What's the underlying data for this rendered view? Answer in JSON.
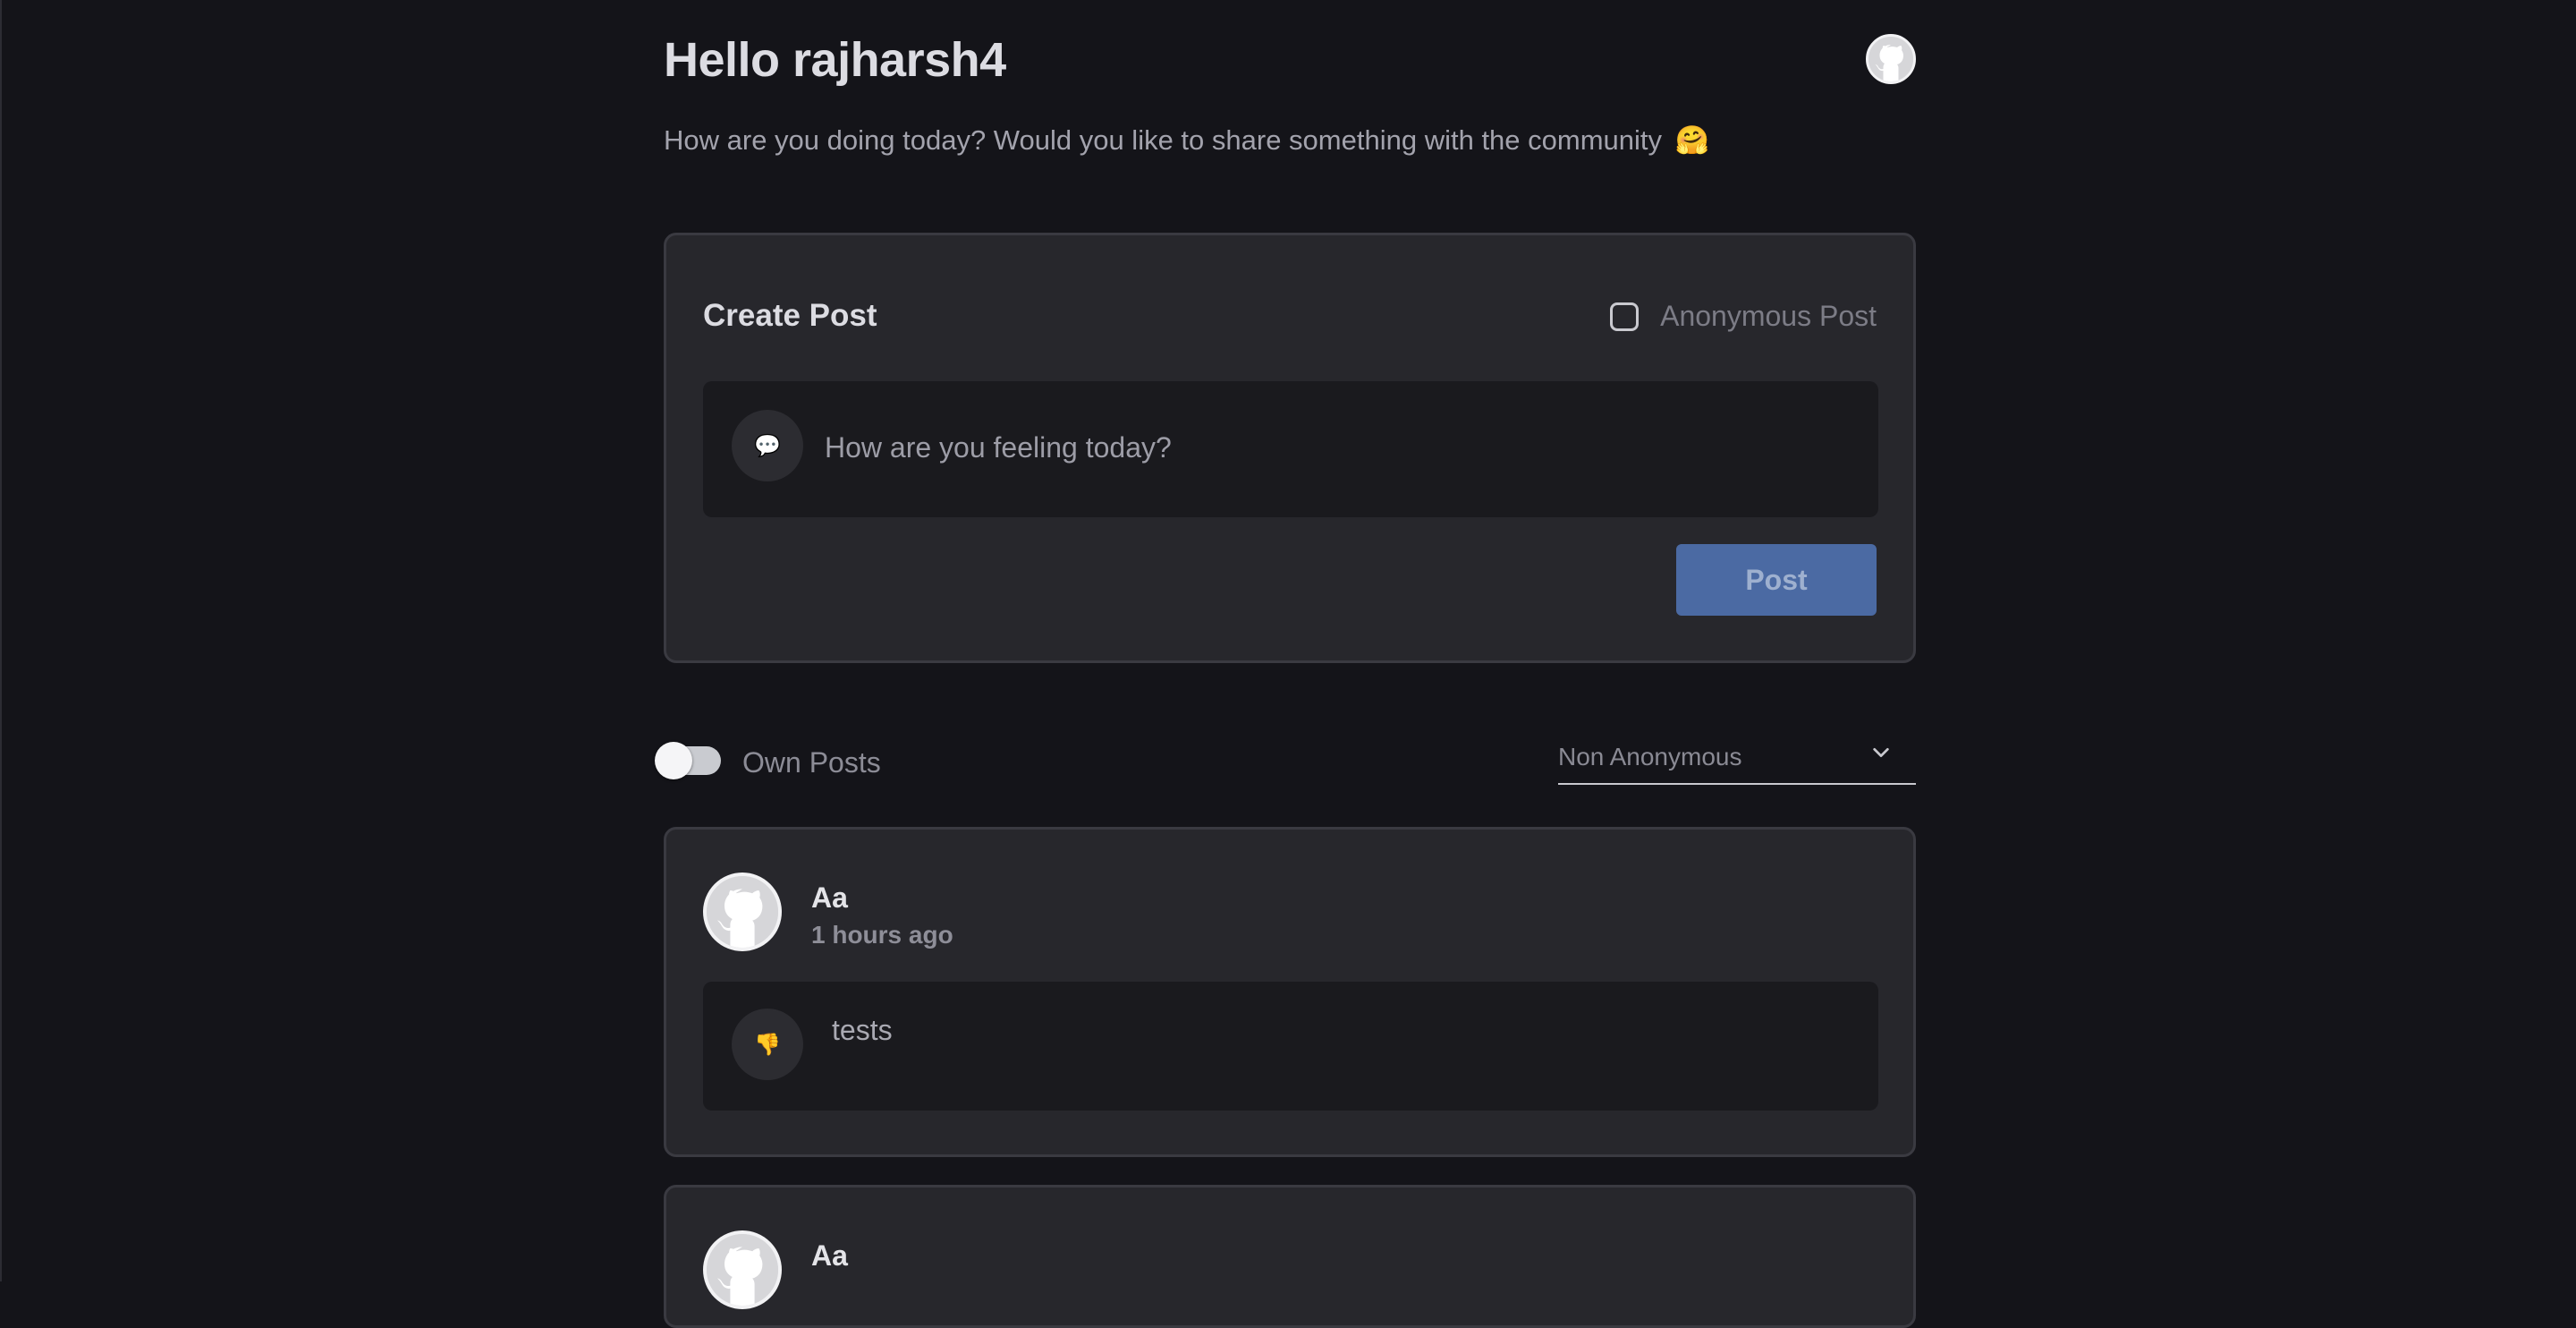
{
  "header": {
    "greeting": "Hello rajharsh4",
    "subtitle": "How are you doing today? Would you like to share something with the community",
    "subtitle_emoji": "🤗",
    "avatar_icon": "github-octocat-icon"
  },
  "create_post": {
    "title": "Create Post",
    "anonymous_label": "Anonymous Post",
    "anonymous_checked": false,
    "input_icon": "💬",
    "input_placeholder": "How are you feeling today?",
    "post_button": "Post",
    "post_button_color": "#4b6aa3"
  },
  "filters": {
    "own_posts_label": "Own Posts",
    "own_posts_on": false,
    "visibility_selected": "Non Anonymous"
  },
  "posts": [
    {
      "author": "Aa",
      "time": "1 hours ago",
      "reaction_icon": "👎",
      "text": "tests"
    },
    {
      "author": "Aa"
    }
  ],
  "colors": {
    "background": "#141419",
    "card": "#27272c",
    "accent": "#4b6aa3"
  }
}
